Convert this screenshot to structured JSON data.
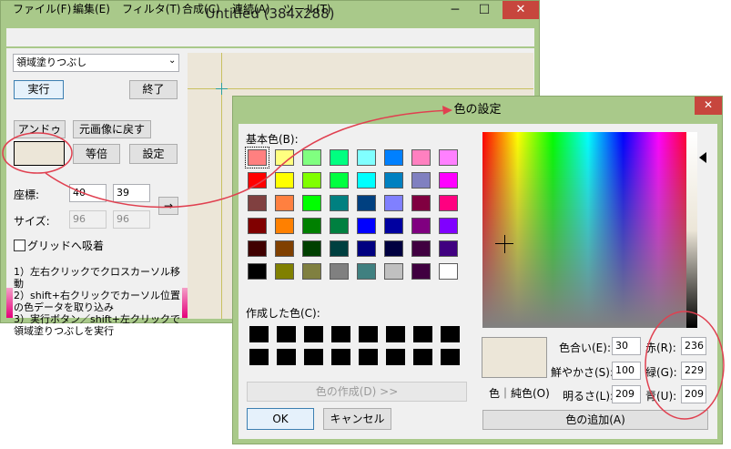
{
  "main_window": {
    "title": "Untitled (384x288)",
    "minimize": "─",
    "maximize": "☐",
    "close": "✕",
    "menu": [
      "ファイル(F)",
      "編集(E)",
      "フィルタ(T)",
      "合成(C)",
      "連続(A)",
      "ツール(T)"
    ],
    "tool_select": "領域塗りつぶし",
    "run_button": "実行",
    "exit_button": "終了",
    "undo_button": "アンドゥ",
    "restore_button": "元画像に戻す",
    "zoom_button": "等倍",
    "settings_button": "設定",
    "coord_label": "座標:",
    "coord_x": "40",
    "coord_y": "39",
    "size_label": "サイズ:",
    "size_w": "96",
    "size_h": "96",
    "arrow_button": "→",
    "snap_label": "グリッドへ吸着",
    "instructions": [
      "1）左右クリックでクロスカーソル移動",
      "2）shift+右クリックでカーソル位置",
      "の色データを取り込み",
      "3）実行ボタン／shift+左クリックで",
      "領域塗りつぶしを実行"
    ],
    "current_color": "#ece6d8"
  },
  "color_dialog": {
    "title": "色の設定",
    "close": "✕",
    "basic_colors_label": "基本色(B):",
    "basic_colors": [
      "#ff8080",
      "#ffff80",
      "#80ff80",
      "#00ff80",
      "#80ffff",
      "#0080ff",
      "#ff80c0",
      "#ff80ff",
      "#ff0000",
      "#ffff00",
      "#80ff00",
      "#00ff40",
      "#00ffff",
      "#0080c0",
      "#8080c0",
      "#ff00ff",
      "#804040",
      "#ff8040",
      "#00ff00",
      "#008080",
      "#004080",
      "#8080ff",
      "#800040",
      "#ff0080",
      "#800000",
      "#ff8000",
      "#008000",
      "#008040",
      "#0000ff",
      "#0000a0",
      "#800080",
      "#8000ff",
      "#400000",
      "#804000",
      "#004000",
      "#004040",
      "#000080",
      "#000040",
      "#400040",
      "#400080",
      "#000000",
      "#808000",
      "#808040",
      "#808080",
      "#408080",
      "#c0c0c0",
      "#400040",
      "#ffffff"
    ],
    "custom_colors_label": "作成した色(C):",
    "custom_colors": [
      "#000000",
      "#000000",
      "#000000",
      "#000000",
      "#000000",
      "#000000",
      "#000000",
      "#000000",
      "#000000",
      "#000000",
      "#000000",
      "#000000",
      "#000000",
      "#000000",
      "#000000",
      "#000000"
    ],
    "define_button": "色の作成(D) >>",
    "ok_button": "OK",
    "cancel_button": "キャンセル",
    "preview_label": "色｜純色(O)",
    "hue_label": "色合い(E):",
    "hue": "30",
    "sat_label": "鮮やかさ(S):",
    "sat": "100",
    "lum_label": "明るさ(L):",
    "lum": "209",
    "red_label": "赤(R):",
    "red": "236",
    "green_label": "緑(G):",
    "green": "229",
    "blue_label": "青(U):",
    "blue": "209",
    "add_button": "色の追加(A)",
    "selected_color": "#ece6d8"
  }
}
